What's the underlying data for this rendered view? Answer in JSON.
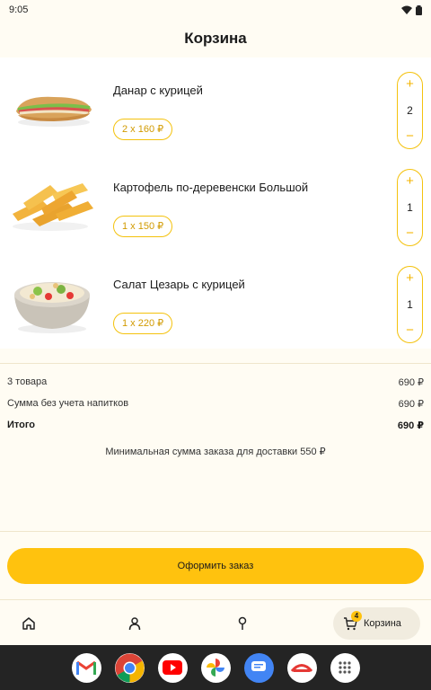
{
  "status_bar": {
    "time": "9:05"
  },
  "header": {
    "title": "Корзина"
  },
  "cart": {
    "items": [
      {
        "name": "Данар с курицей",
        "price_label": "2 х 160 ₽",
        "quantity": "2"
      },
      {
        "name": "Картофель по-деревенски Большой",
        "price_label": "1 х 150 ₽",
        "quantity": "1"
      },
      {
        "name": "Салат Цезарь с курицей",
        "price_label": "1 х 220 ₽",
        "quantity": "1"
      }
    ],
    "plus_symbol": "+",
    "minus_symbol": "−"
  },
  "summary": {
    "count_label": "3 товара",
    "count_value": "690 ₽",
    "without_drinks_label": "Сумма без учета напитков",
    "without_drinks_value": "690 ₽",
    "total_label": "Итого",
    "total_value": "690 ₽",
    "min_order_note": "Минимальная сумма заказа для доставки 550 ₽"
  },
  "checkout": {
    "label": "Оформить заказ"
  },
  "bottom_nav": {
    "items": [
      "home-icon",
      "profile-icon",
      "location-pin-icon",
      "cart-icon"
    ],
    "cart_label": "Корзина",
    "cart_badge": "4"
  },
  "dock": {
    "apps": [
      "gmail-icon",
      "chrome-icon",
      "youtube-icon",
      "photos-icon",
      "messages-icon",
      "danar-app-icon",
      "app-drawer-icon"
    ]
  },
  "colors": {
    "accent": "#FFC20E",
    "outline": "#F4C20D",
    "background": "#FFFCF3"
  }
}
